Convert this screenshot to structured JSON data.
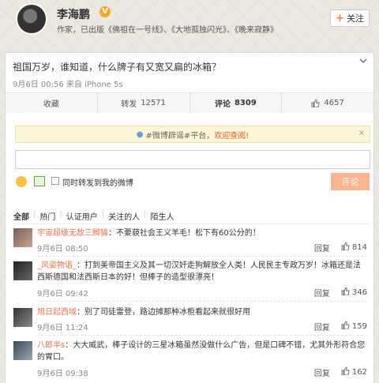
{
  "profile": {
    "name": "李海鹏",
    "verified_badge": "V",
    "description": "作家，已出版《佛祖在一号线》、《大地孤独闪光》、《晚来寂静》",
    "follow_label": "关注",
    "follow_icon": "+"
  },
  "post": {
    "text": "祖国万岁，谁知道，什么牌子有又宽又扁的冰箱？",
    "meta": "9月6日 00:56 来自 iPhone 5s",
    "actions": [
      {
        "label": "收藏",
        "count": ""
      },
      {
        "label": "转发",
        "count": "12571"
      },
      {
        "label": "评论",
        "count": "8309"
      },
      {
        "label": "",
        "count": "4657"
      }
    ]
  },
  "compose": {
    "notice_prefix": "#微博辟谣#平台，",
    "notice_link": "欢迎查阅!",
    "close_label": "×",
    "input_value": "",
    "repost_label": "同时转发到我的微博",
    "submit_label": "评论"
  },
  "filters": [
    "全部",
    "热门",
    "认证用户",
    "关注的人",
    "陌生人"
  ],
  "comments": [
    {
      "user": "宇宙超级无敌三脚猫",
      "text": "：不要藐社会王义羊毛！松下有60公分的！",
      "time": "9月6日 08:50",
      "reply": "回复",
      "likes": "814"
    },
    {
      "user": "_风姿物语_",
      "text": "：打到美帝国主义及其一切汉奸走狗解放全人类！人民民主专政万岁！冰箱还是法西斯德国和法西斯日本的好！但棒子的造型很漂亮！",
      "time": "9月6日 09:42",
      "reply": "回复",
      "likes": "346"
    },
    {
      "user": "旭日起西域",
      "text": "：别了司徒雷登，路边摊那种冰柜看起来就很好用",
      "time": "9月6日 11:24",
      "reply": "回复",
      "likes": "159"
    },
    {
      "user": "八郎半s",
      "text": "：大大威武，棒子设计的三星冰箱虽然没做什么广告，但是口碑不错，尤其外形符合您的胃口。",
      "time": "9月6日 09:38",
      "reply": "回复",
      "likes": "162"
    }
  ],
  "colors": {
    "accent": "#eb7350",
    "submit_disabled": "#fbb48d",
    "badge": "#f5a623"
  }
}
